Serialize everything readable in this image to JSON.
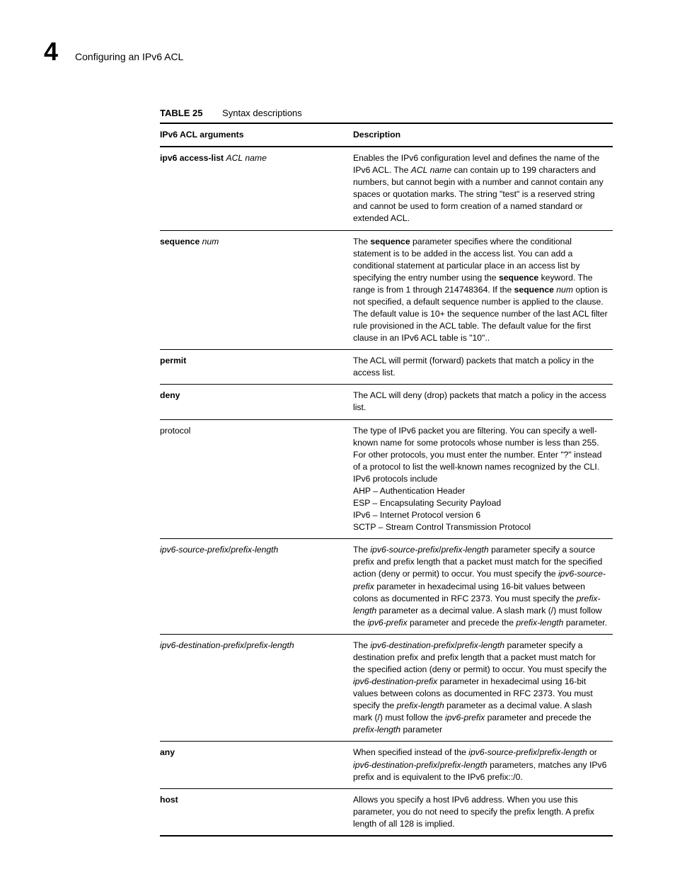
{
  "header": {
    "chapter_number": "4",
    "section_title": "Configuring an IPv6 ACL"
  },
  "table": {
    "caption_label": "TABLE 25",
    "caption_text": "Syntax descriptions",
    "head": {
      "col1": "IPv6 ACL arguments",
      "col2": "Description"
    },
    "rows": [
      {
        "arg": [
          {
            "t": "ipv6 access-list ",
            "b": true
          },
          {
            "t": "ACL name",
            "i": true
          }
        ],
        "desc": [
          {
            "t": "Enables the IPv6 configuration level and defines the name of the IPv6 ACL. The "
          },
          {
            "t": "ACL name",
            "i": true
          },
          {
            "t": " can contain up to 199 characters and numbers, but cannot begin with a number and cannot contain any spaces or quotation marks. The string \"test\" is a reserved string and cannot be used to form creation of a named standard or extended ACL."
          }
        ]
      },
      {
        "arg": [
          {
            "t": "sequence ",
            "b": true
          },
          {
            "t": "num",
            "i": true
          }
        ],
        "desc": [
          {
            "t": "The "
          },
          {
            "t": "sequence",
            "b": true
          },
          {
            "t": " parameter specifies where the conditional statement is to be added in the access list. You can add a conditional statement at particular place in an access list by specifying the entry number using the "
          },
          {
            "t": "sequence",
            "b": true
          },
          {
            "t": " keyword. The range is from 1 through 214748364. If the "
          },
          {
            "t": "sequence",
            "b": true
          },
          {
            "t": " "
          },
          {
            "t": "num",
            "i": true
          },
          {
            "t": " option is not specified, a default sequence number is applied to the clause. The default value is 10+ the sequence number of the last ACL filter rule provisioned in the ACL table. The default value for the first clause in an IPv6 ACL table is \"10\".."
          }
        ]
      },
      {
        "arg": [
          {
            "t": "permit",
            "b": true
          }
        ],
        "desc": [
          {
            "t": "The ACL will permit (forward) packets that match a policy in the access list."
          }
        ]
      },
      {
        "arg": [
          {
            "t": "deny",
            "b": true
          }
        ],
        "desc": [
          {
            "t": "The ACL will deny (drop) packets that match a policy in the access list."
          }
        ]
      },
      {
        "arg": [
          {
            "t": "protocol"
          }
        ],
        "desc": [
          {
            "t": "The type of IPv6 packet you are filtering. You can specify a well-known name for some protocols whose number is less than 255. For other protocols, you must enter the number. Enter \"?\" instead of a protocol to list the well-known names recognized by the CLI. IPv6 protocols include"
          },
          {
            "br": true
          },
          {
            "t": "AHP – Authentication Header"
          },
          {
            "br": true
          },
          {
            "t": "ESP – Encapsulating Security Payload"
          },
          {
            "br": true
          },
          {
            "t": "IPv6 – Internet Protocol version 6"
          },
          {
            "br": true
          },
          {
            "t": "SCTP – Stream Control Transmission Protocol"
          }
        ]
      },
      {
        "arg": [
          {
            "t": "ipv6-source-prefix",
            "i": true
          },
          {
            "t": "/"
          },
          {
            "t": "prefix-length",
            "i": true
          }
        ],
        "desc": [
          {
            "t": "The "
          },
          {
            "t": "ipv6-source-prefix",
            "i": true
          },
          {
            "t": "/"
          },
          {
            "t": "prefix-length",
            "i": true
          },
          {
            "t": " parameter specify a source prefix and prefix length that a packet must match for the specified action (deny or permit) to occur. You must specify the "
          },
          {
            "t": "ipv6-source-prefix",
            "i": true
          },
          {
            "t": " parameter in hexadecimal using 16-bit values between colons as documented in RFC 2373. You must specify the "
          },
          {
            "t": "prefix-length",
            "i": true
          },
          {
            "t": " parameter as a decimal value. A slash mark (/) must follow the "
          },
          {
            "t": "ipv6-prefix",
            "i": true
          },
          {
            "t": " parameter and precede the "
          },
          {
            "t": "prefix-length",
            "i": true
          },
          {
            "t": " parameter."
          }
        ]
      },
      {
        "arg": [
          {
            "t": "ipv6-destination-prefix",
            "i": true
          },
          {
            "t": "/"
          },
          {
            "t": "prefix-length",
            "i": true
          }
        ],
        "desc": [
          {
            "t": "The "
          },
          {
            "t": "ipv6-destination-prefix",
            "i": true
          },
          {
            "t": "/"
          },
          {
            "t": "prefix-length",
            "i": true
          },
          {
            "t": " parameter specify a destination prefix and prefix length that a packet must match for the specified action (deny or permit) to occur. You must specify the "
          },
          {
            "t": "ipv6-destination-prefix",
            "i": true
          },
          {
            "t": " parameter in hexadecimal using 16-bit values between colons as documented in RFC 2373. You must specify the "
          },
          {
            "t": "prefix-length",
            "i": true
          },
          {
            "t": " parameter as a decimal value. A slash mark (/) must follow the "
          },
          {
            "t": "ipv6-prefix",
            "i": true
          },
          {
            "t": " parameter and precede the "
          },
          {
            "t": "prefix-length",
            "i": true
          },
          {
            "t": " parameter"
          }
        ]
      },
      {
        "arg": [
          {
            "t": "any",
            "b": true
          }
        ],
        "desc": [
          {
            "t": "When specified instead of the "
          },
          {
            "t": "ipv6-source-prefix",
            "i": true
          },
          {
            "t": "/"
          },
          {
            "t": "prefix-length",
            "i": true
          },
          {
            "t": " or "
          },
          {
            "t": "ipv6-destination-prefix",
            "i": true
          },
          {
            "t": "/"
          },
          {
            "t": "prefix-length",
            "i": true
          },
          {
            "t": " parameters, matches any IPv6 prefix and is equivalent to the IPv6 prefix::/0."
          }
        ]
      },
      {
        "arg": [
          {
            "t": "host",
            "b": true
          }
        ],
        "desc": [
          {
            "t": "Allows you specify a host IPv6 address. When you use this parameter, you do not need to specify the prefix length. A prefix length of all 128 is implied."
          }
        ]
      }
    ]
  }
}
